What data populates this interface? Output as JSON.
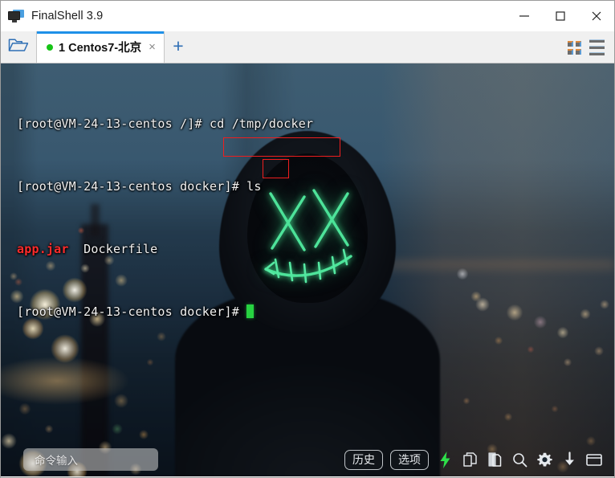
{
  "window": {
    "title": "FinalShell 3.9",
    "app_icon": "monitor-icon",
    "controls": {
      "minimize": "minimize-icon",
      "maximize": "maximize-icon",
      "close": "close-icon"
    }
  },
  "tabbar": {
    "folder_button_icon": "open-folder-icon",
    "tabs": [
      {
        "label": "1 Centos7-北京",
        "status": "connected",
        "status_color": "#16c416",
        "close_label": "×",
        "active": true
      }
    ],
    "new_tab_label": "+",
    "right_icons": [
      {
        "name": "grid-view-icon"
      },
      {
        "name": "list-view-icon"
      }
    ]
  },
  "terminal": {
    "colors": {
      "text": "#f2f2f2",
      "file_archive": "#ff2b2b",
      "cursor": "#27d341",
      "annotation": "#ef1e1e"
    },
    "lines": [
      {
        "id": "line-1",
        "segments": [
          {
            "text": "[root@VM-24-13-centos /]# ",
            "style": "normal"
          },
          {
            "text": "cd /tmp/docker",
            "style": "normal"
          }
        ]
      },
      {
        "id": "line-2",
        "segments": [
          {
            "text": "[root@VM-24-13-centos docker]# ",
            "style": "normal"
          },
          {
            "text": "ls",
            "style": "normal"
          }
        ]
      },
      {
        "id": "line-3",
        "segments": [
          {
            "text": "app.jar",
            "style": "archive"
          },
          {
            "text": "  Dockerfile",
            "style": "normal"
          }
        ]
      },
      {
        "id": "line-4",
        "segments": [
          {
            "text": "[root@VM-24-13-centos docker]# ",
            "style": "normal"
          },
          {
            "text": "",
            "style": "cursor"
          }
        ]
      }
    ],
    "annotations": [
      {
        "id": "annot-cd",
        "target": "cd /tmp/docker"
      },
      {
        "id": "annot-ls",
        "target": "ls"
      }
    ]
  },
  "bottombar": {
    "command_input_placeholder": "命令输入",
    "buttons": [
      {
        "label": "历史",
        "name": "history-button"
      },
      {
        "label": "选项",
        "name": "options-button"
      }
    ],
    "tools": [
      {
        "name": "lightning-icon",
        "color": "#2ee04a"
      },
      {
        "name": "copy-icon"
      },
      {
        "name": "paste-icon"
      },
      {
        "name": "search-icon"
      },
      {
        "name": "gear-icon"
      },
      {
        "name": "download-icon"
      },
      {
        "name": "window-icon"
      }
    ]
  }
}
